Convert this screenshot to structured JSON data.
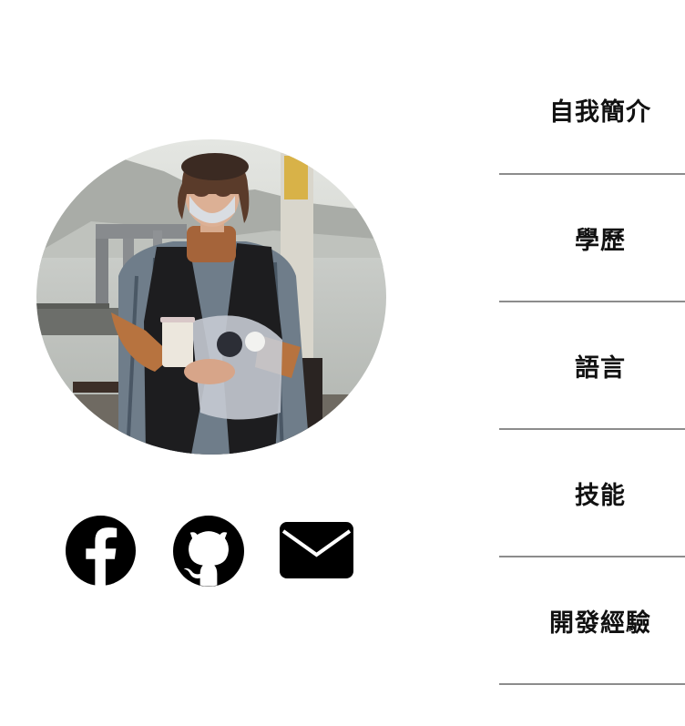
{
  "profile": {
    "photo_alt": "profile photo"
  },
  "social": [
    {
      "name": "facebook",
      "icon": "facebook-icon"
    },
    {
      "name": "github",
      "icon": "github-icon"
    },
    {
      "name": "email",
      "icon": "mail-icon"
    }
  ],
  "nav": {
    "items": [
      {
        "label": "自我簡介"
      },
      {
        "label": "學歷"
      },
      {
        "label": "語言"
      },
      {
        "label": "技能"
      },
      {
        "label": "開發經驗"
      }
    ]
  },
  "colors": {
    "text": "#111111",
    "divider": "#8c8c8c",
    "icon": "#000000",
    "background": "#ffffff"
  }
}
